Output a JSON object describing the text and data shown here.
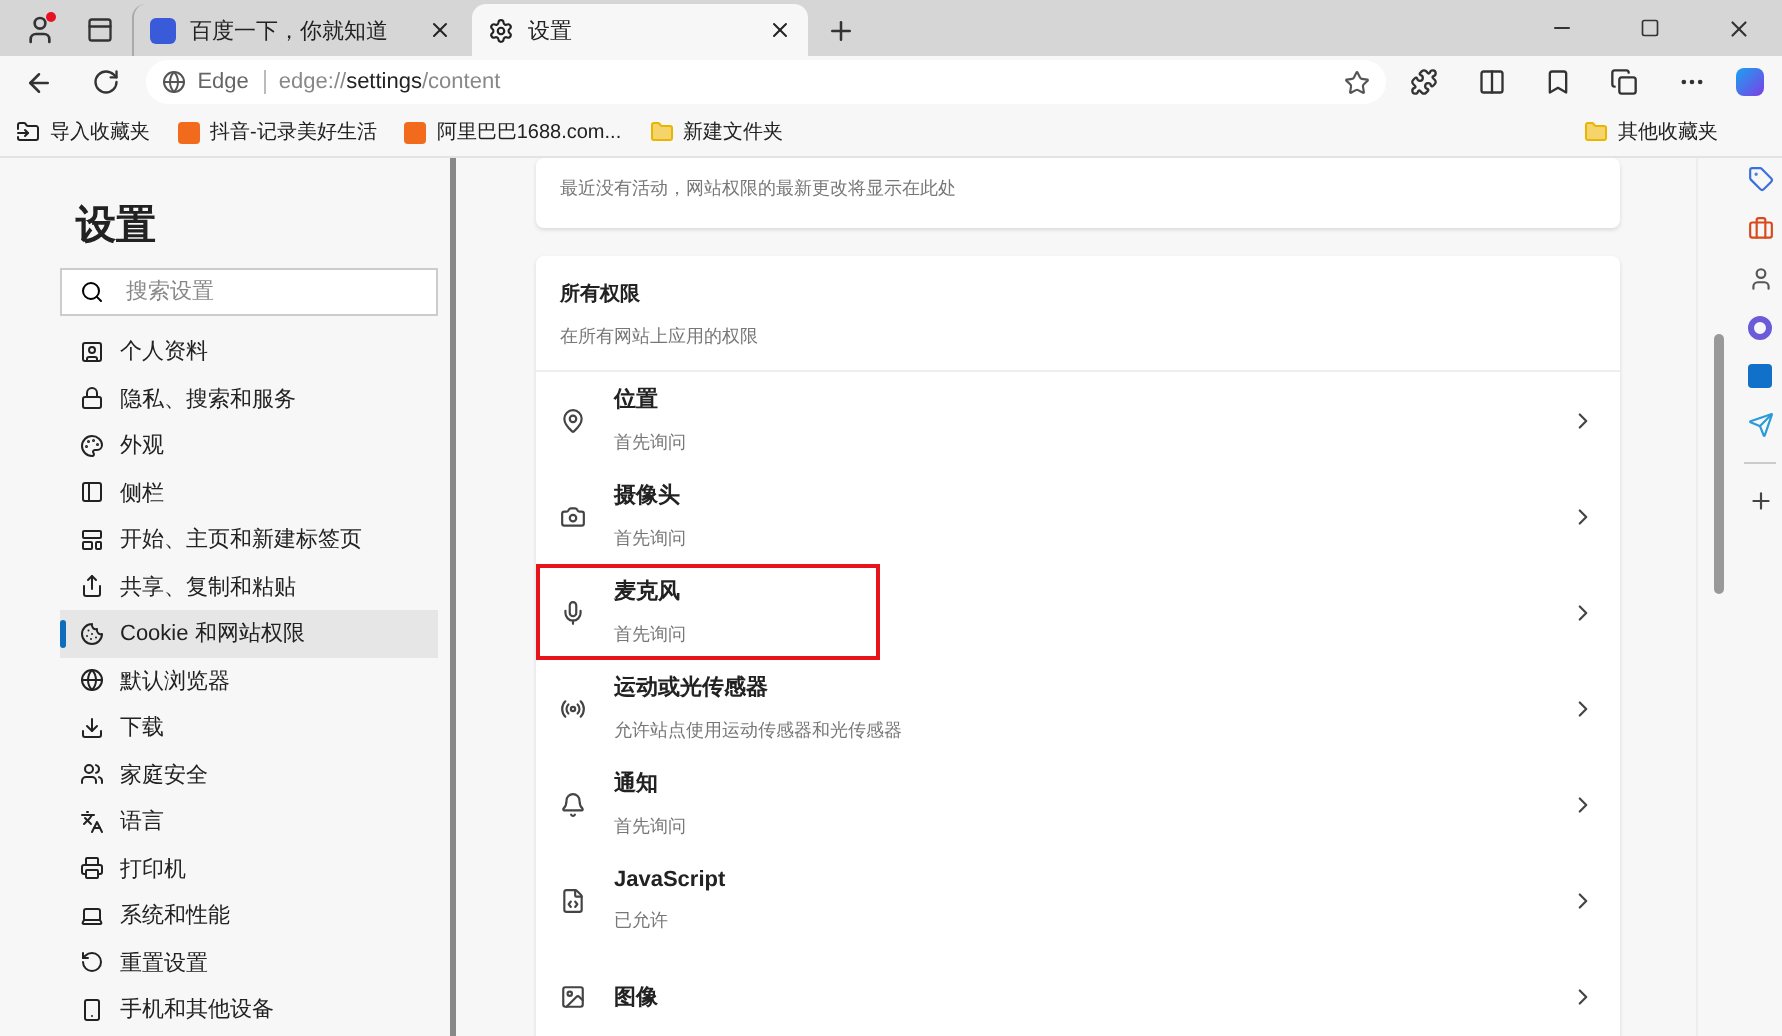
{
  "tabs": [
    {
      "title": "百度一下，你就知道",
      "selected": false
    },
    {
      "title": "设置",
      "selected": true
    }
  ],
  "address": {
    "brand": "Edge",
    "url": "edge://**settings**/content"
  },
  "bookmarks": {
    "items": [
      {
        "label": "导入收藏夹",
        "kind": "import"
      },
      {
        "label": "抖音-记录美好生活",
        "kind": "site"
      },
      {
        "label": "阿里巴巴1688.com...",
        "kind": "site"
      },
      {
        "label": "新建文件夹",
        "kind": "folder"
      }
    ],
    "other": "其他收藏夹"
  },
  "sidebar": {
    "title": "设置",
    "search_placeholder": "搜索设置",
    "items": [
      {
        "label": "个人资料",
        "selected": false
      },
      {
        "label": "隐私、搜索和服务",
        "selected": false
      },
      {
        "label": "外观",
        "selected": false
      },
      {
        "label": "侧栏",
        "selected": false
      },
      {
        "label": "开始、主页和新建标签页",
        "selected": false
      },
      {
        "label": "共享、复制和粘贴",
        "selected": false
      },
      {
        "label": "Cookie 和网站权限",
        "selected": true
      },
      {
        "label": "默认浏览器",
        "selected": false
      },
      {
        "label": "下载",
        "selected": false
      },
      {
        "label": "家庭安全",
        "selected": false
      },
      {
        "label": "语言",
        "selected": false
      },
      {
        "label": "打印机",
        "selected": false
      },
      {
        "label": "系统和性能",
        "selected": false
      },
      {
        "label": "重置设置",
        "selected": false
      },
      {
        "label": "手机和其他设备",
        "selected": false
      }
    ]
  },
  "recent_activity": {
    "text": "最近没有活动，网站权限的最新更改将显示在此处"
  },
  "permissions": {
    "title": "所有权限",
    "subtitle": "在所有网站上应用的权限",
    "items": [
      {
        "title": "位置",
        "subtitle": "首先询问",
        "highlighted": false
      },
      {
        "title": "摄像头",
        "subtitle": "首先询问",
        "highlighted": false
      },
      {
        "title": "麦克风",
        "subtitle": "首先询问",
        "highlighted": true
      },
      {
        "title": "运动或光传感器",
        "subtitle": "允许站点使用运动传感器和光传感器",
        "highlighted": false
      },
      {
        "title": "通知",
        "subtitle": "首先询问",
        "highlighted": false
      },
      {
        "title": "JavaScript",
        "subtitle": "已允许",
        "highlighted": false
      },
      {
        "title": "图像",
        "highlighted": false
      }
    ]
  }
}
